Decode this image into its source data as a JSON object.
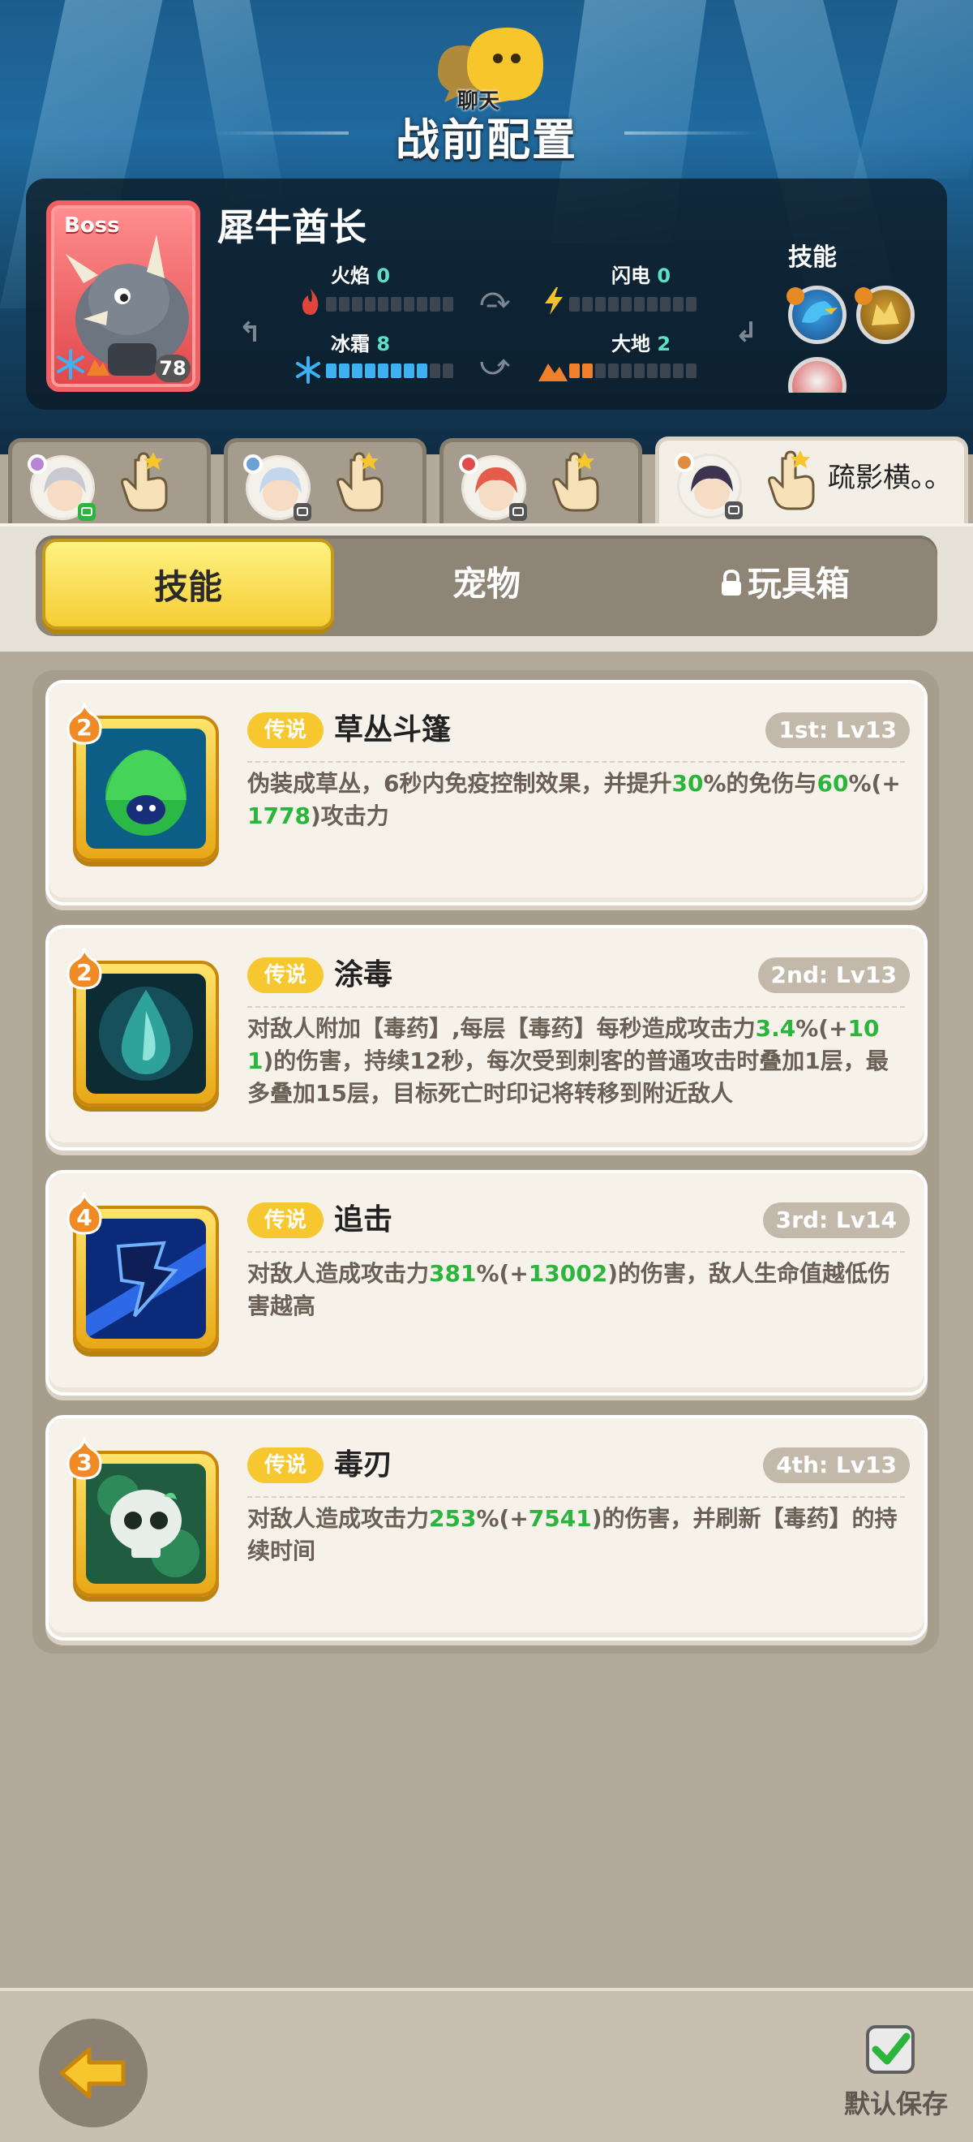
{
  "header": {
    "chat_label": "聊天",
    "title": "战前配置"
  },
  "boss": {
    "tag": "Boss",
    "name": "犀牛酋长",
    "level": "78",
    "elements": {
      "fire": {
        "label": "火焰",
        "value": "0",
        "level": 0
      },
      "lightning": {
        "label": "闪电",
        "value": "0",
        "level": 0
      },
      "ice": {
        "label": "冰霜",
        "value": "8",
        "level": 8
      },
      "earth": {
        "label": "大地",
        "value": "2",
        "level": 2
      }
    },
    "skills_label": "技能",
    "skill_orbs": [
      {
        "icon": "blue-bird-icon",
        "number": ""
      },
      {
        "icon": "golden-beast-icon",
        "number": ""
      },
      {
        "icon": "red-white-shield-icon",
        "number": ""
      }
    ]
  },
  "heroes": [
    {
      "name": "",
      "icon": "silver-hair-hero-portrait",
      "active": false
    },
    {
      "name": "",
      "icon": "blue-hair-hero-portrait",
      "active": false
    },
    {
      "name": "",
      "icon": "red-hair-hero-portrait",
      "active": false
    },
    {
      "name": "疏影横。。",
      "icon": "dark-hair-hero-portrait",
      "active": true
    }
  ],
  "tabs": [
    {
      "label": "技能",
      "active": true,
      "locked": false
    },
    {
      "label": "宠物",
      "active": false,
      "locked": false
    },
    {
      "label": "玩具箱",
      "active": false,
      "locked": true
    }
  ],
  "skills": [
    {
      "rank": "2",
      "rarity": "传说",
      "name": "草丛斗篷",
      "slot": "1st: Lv13",
      "icon": "bush-cloak-icon",
      "desc_parts": [
        {
          "t": "伪装成草丛，6秒内免疫控制效果，并提升",
          "g": false
        },
        {
          "t": "30",
          "g": true
        },
        {
          "t": "%的免伤与",
          "g": false
        },
        {
          "t": "60",
          "g": true
        },
        {
          "t": "%(+",
          "g": false
        },
        {
          "t": "1778",
          "g": true
        },
        {
          "t": ")攻击力",
          "g": false
        }
      ]
    },
    {
      "rank": "2",
      "rarity": "传说",
      "name": "涂毒",
      "slot": "2nd: Lv13",
      "icon": "poison-drop-icon",
      "desc_parts": [
        {
          "t": "对敌人附加【毒药】,每层【毒药】每秒造成攻击力",
          "g": false
        },
        {
          "t": "3.4",
          "g": true
        },
        {
          "t": "%(+",
          "g": false
        },
        {
          "t": "101",
          "g": true
        },
        {
          "t": ")的伤害，持续12秒，每次受到刺客的普通攻击时叠加1层，最多叠加15层，目标死亡时印记将转移到附近敌人",
          "g": false
        }
      ]
    },
    {
      "rank": "4",
      "rarity": "传说",
      "name": "追击",
      "slot": "3rd: Lv14",
      "icon": "pursuit-strike-icon",
      "desc_parts": [
        {
          "t": "对敌人造成攻击力",
          "g": false
        },
        {
          "t": "381",
          "g": true
        },
        {
          "t": "%(+",
          "g": false
        },
        {
          "t": "13002",
          "g": true
        },
        {
          "t": ")的伤害，敌人生命值越低伤害越高",
          "g": false
        }
      ]
    },
    {
      "rank": "3",
      "rarity": "传说",
      "name": "毒刃",
      "slot": "4th: Lv13",
      "icon": "poison-skull-icon",
      "desc_parts": [
        {
          "t": "对敌人造成攻击力",
          "g": false
        },
        {
          "t": "253",
          "g": true
        },
        {
          "t": "%(+",
          "g": false
        },
        {
          "t": "7541",
          "g": true
        },
        {
          "t": ")的伤害，并刷新【毒药】的持续时间",
          "g": false
        }
      ]
    }
  ],
  "footer": {
    "save_label": "默认保存",
    "save_checked": true
  }
}
